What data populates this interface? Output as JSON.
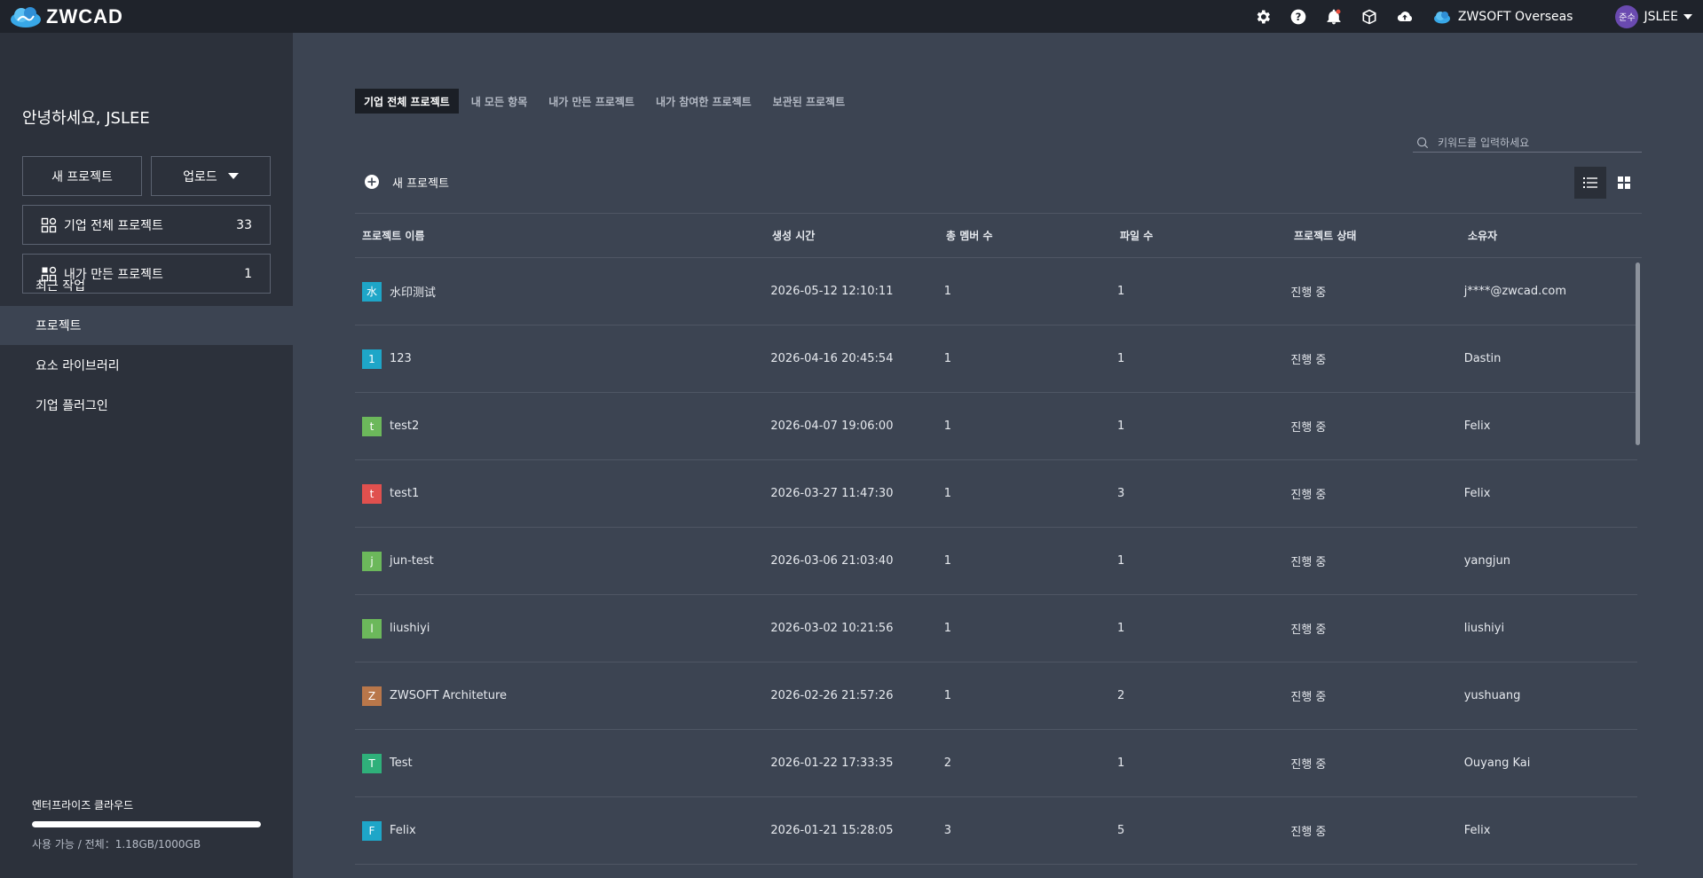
{
  "header": {
    "logo_text": "ZWCAD",
    "org_name": "ZWSOFT Overseas",
    "user_avatar": "준수",
    "user_name": "JSLEE",
    "icons": [
      "gear-icon",
      "help-icon",
      "bell-icon",
      "box-icon",
      "cloud-upload-icon"
    ]
  },
  "sidebar": {
    "greeting": "안녕하세요, JSLEE",
    "new_project_label": "새 프로젝트",
    "upload_label": "업로드",
    "company_projects": {
      "label": "기업 전체 프로젝트",
      "count": "33"
    },
    "my_projects": {
      "label": "내가 만든 프로젝트",
      "count": "1"
    },
    "nav": [
      {
        "label": "최근 작업",
        "active": false
      },
      {
        "label": "프로젝트",
        "active": true
      },
      {
        "label": "요소 라이브러리",
        "active": false
      },
      {
        "label": "기업 플러그인",
        "active": false
      }
    ],
    "storage": {
      "title": "엔터프라이즈 클라우드",
      "usage_text": "사용 가능 / 전체：1.18GB/1000GB",
      "remaining_fraction": 0.9988
    }
  },
  "main": {
    "tabs": [
      {
        "label": "기업 전체 프로젝트",
        "active": true
      },
      {
        "label": "내 모든 항목",
        "active": false
      },
      {
        "label": "내가 만든 프로젝트",
        "active": false
      },
      {
        "label": "내가 참여한 프로젝트",
        "active": false
      },
      {
        "label": "보관된 프로젝트",
        "active": false
      }
    ],
    "search_placeholder": "키워드를 입력하세요",
    "new_project_label": "새 프로젝트",
    "columns": [
      "프로젝트 이름",
      "생성 시간",
      "총 멤버 수",
      "파일 수",
      "프로젝트 상태",
      "소유자"
    ],
    "rows": [
      {
        "badge": "水",
        "badge_color": "#1ea6c8",
        "name": "水印测试",
        "created": "2026-05-12 12:10:11",
        "members": "1",
        "files": "1",
        "status": "진행 중",
        "owner": "j****@zwcad.com"
      },
      {
        "badge": "1",
        "badge_color": "#1ea6c8",
        "name": "123",
        "created": "2026-04-16 20:45:54",
        "members": "1",
        "files": "1",
        "status": "진행 중",
        "owner": "Dastin"
      },
      {
        "badge": "t",
        "badge_color": "#6cb85b",
        "name": "test2",
        "created": "2026-04-07 19:06:00",
        "members": "1",
        "files": "1",
        "status": "진행 중",
        "owner": "Felix"
      },
      {
        "badge": "t",
        "badge_color": "#e0504e",
        "name": "test1",
        "created": "2026-03-27 11:47:30",
        "members": "1",
        "files": "3",
        "status": "진행 중",
        "owner": "Felix"
      },
      {
        "badge": "j",
        "badge_color": "#6cb85b",
        "name": "jun-test",
        "created": "2026-03-06 21:03:40",
        "members": "1",
        "files": "1",
        "status": "진행 중",
        "owner": "yangjun"
      },
      {
        "badge": "l",
        "badge_color": "#6cb85b",
        "name": "liushiyi",
        "created": "2026-03-02 10:21:56",
        "members": "1",
        "files": "1",
        "status": "진행 중",
        "owner": "liushiyi"
      },
      {
        "badge": "Z",
        "badge_color": "#b9774a",
        "name": "ZWSOFT Architeture",
        "created": "2026-02-26 21:57:26",
        "members": "1",
        "files": "2",
        "status": "진행 중",
        "owner": "yushuang"
      },
      {
        "badge": "T",
        "badge_color": "#2fb07a",
        "name": "Test",
        "created": "2026-01-22 17:33:35",
        "members": "2",
        "files": "1",
        "status": "진행 중",
        "owner": "Ouyang Kai"
      },
      {
        "badge": "F",
        "badge_color": "#1ea6c8",
        "name": "Felix",
        "created": "2026-01-21 15:28:05",
        "members": "3",
        "files": "5",
        "status": "진행 중",
        "owner": "Felix"
      }
    ]
  }
}
